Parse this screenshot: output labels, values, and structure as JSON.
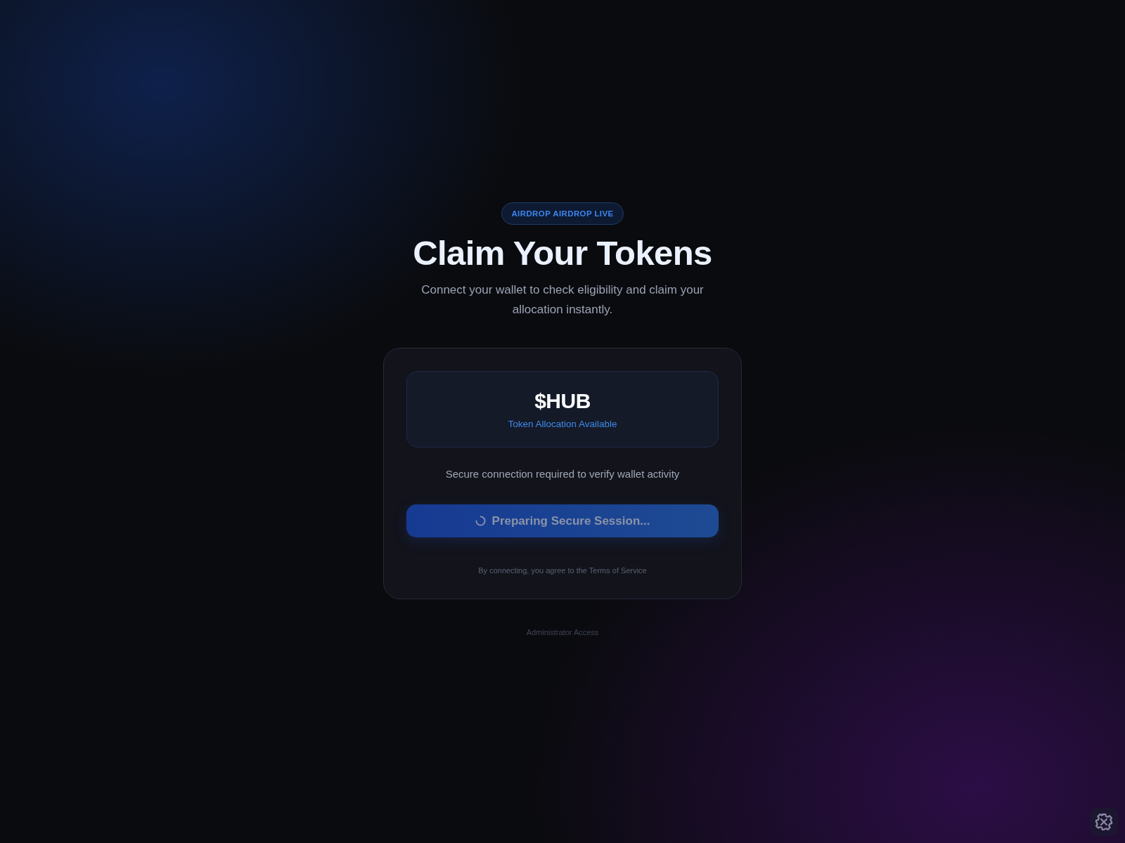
{
  "badge": {
    "label": "AIRDROP AIRDROP LIVE"
  },
  "title": "Claim Your Tokens",
  "subtitle": "Connect your wallet to check eligibility and claim your allocation instantly.",
  "card": {
    "token": {
      "symbol": "$HUB",
      "caption": "Token Allocation Available"
    },
    "notice": "Secure connection required to verify wallet activity",
    "button": {
      "label": "Preparing Secure Session...",
      "loading": true,
      "disabled": true
    },
    "terms": "By connecting, you agree to the Terms of Service"
  },
  "admin_link": "Administrator Access"
}
